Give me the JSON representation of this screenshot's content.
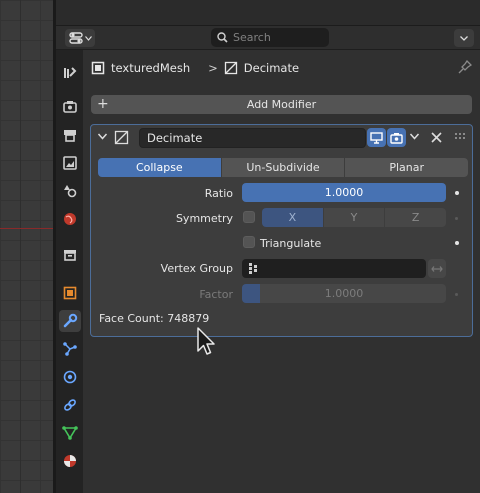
{
  "search": {
    "placeholder": "Search"
  },
  "breadcrumb": {
    "object": "texturedMesh",
    "separator": ">",
    "modifier": "Decimate"
  },
  "add_modifier": {
    "label": "Add Modifier"
  },
  "modifier": {
    "name": "Decimate",
    "modes": [
      {
        "label": "Collapse",
        "active": true
      },
      {
        "label": "Un-Subdivide",
        "active": false
      },
      {
        "label": "Planar",
        "active": false
      }
    ],
    "ratio": {
      "label": "Ratio",
      "value": "1.0000"
    },
    "symmetry": {
      "label": "Symmetry",
      "checked": false,
      "axes": [
        "X",
        "Y",
        "Z"
      ],
      "active_axis": "X"
    },
    "triangulate": {
      "label": "Triangulate",
      "checked": false
    },
    "vertex_group": {
      "label": "Vertex Group",
      "value": ""
    },
    "factor": {
      "label": "Factor",
      "value": "1.0000"
    },
    "face_count": "Face Count: 748879"
  },
  "colors": {
    "accent": "#4772b3",
    "outline": "#4c6d99",
    "panel": "#303030"
  },
  "tabs": [
    "tool-icon",
    "render-icon",
    "output-icon",
    "view-layer-icon",
    "scene-icon",
    "world-icon",
    "collection-icon",
    "object-icon",
    "modifier-icon",
    "particles-icon",
    "physics-icon",
    "constraints-icon",
    "data-icon",
    "material-icon"
  ],
  "active_tab": "modifier-icon"
}
